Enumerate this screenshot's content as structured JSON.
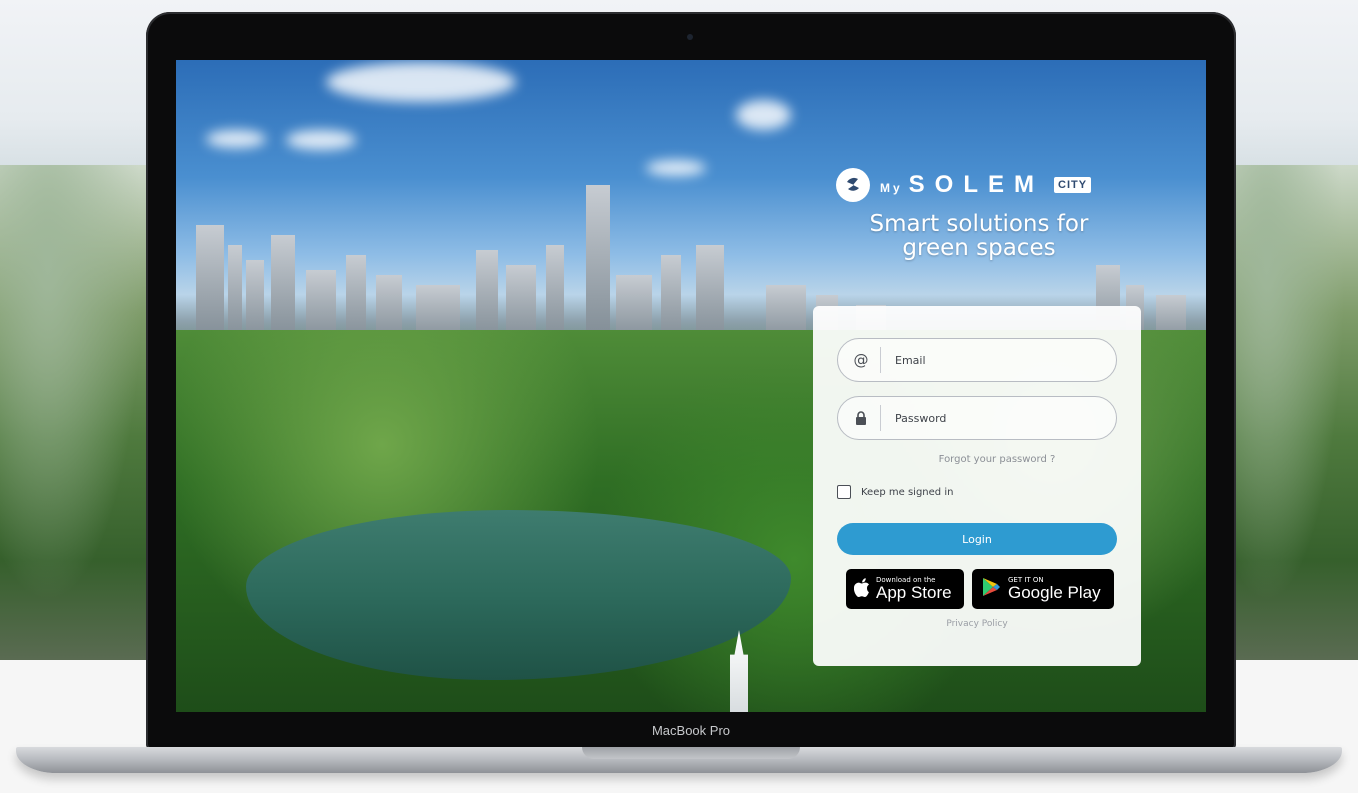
{
  "brand": {
    "prefix": "My",
    "name": "SOLEM",
    "badge": "CITY",
    "tagline": "Smart solutions for green spaces"
  },
  "login": {
    "email_placeholder": "Email",
    "password_placeholder": "Password",
    "forgot_label": "Forgot your password ?",
    "keep_signed_in_label": "Keep me signed in",
    "login_label": "Login",
    "privacy_label": "Privacy Policy"
  },
  "stores": {
    "apple": {
      "top": "Download on the",
      "main": "App Store"
    },
    "google": {
      "top": "GET IT ON",
      "main": "Google Play"
    }
  },
  "device": {
    "label": "MacBook Pro"
  },
  "colors": {
    "accent": "#2e9bd1",
    "card": "#ffffff"
  }
}
